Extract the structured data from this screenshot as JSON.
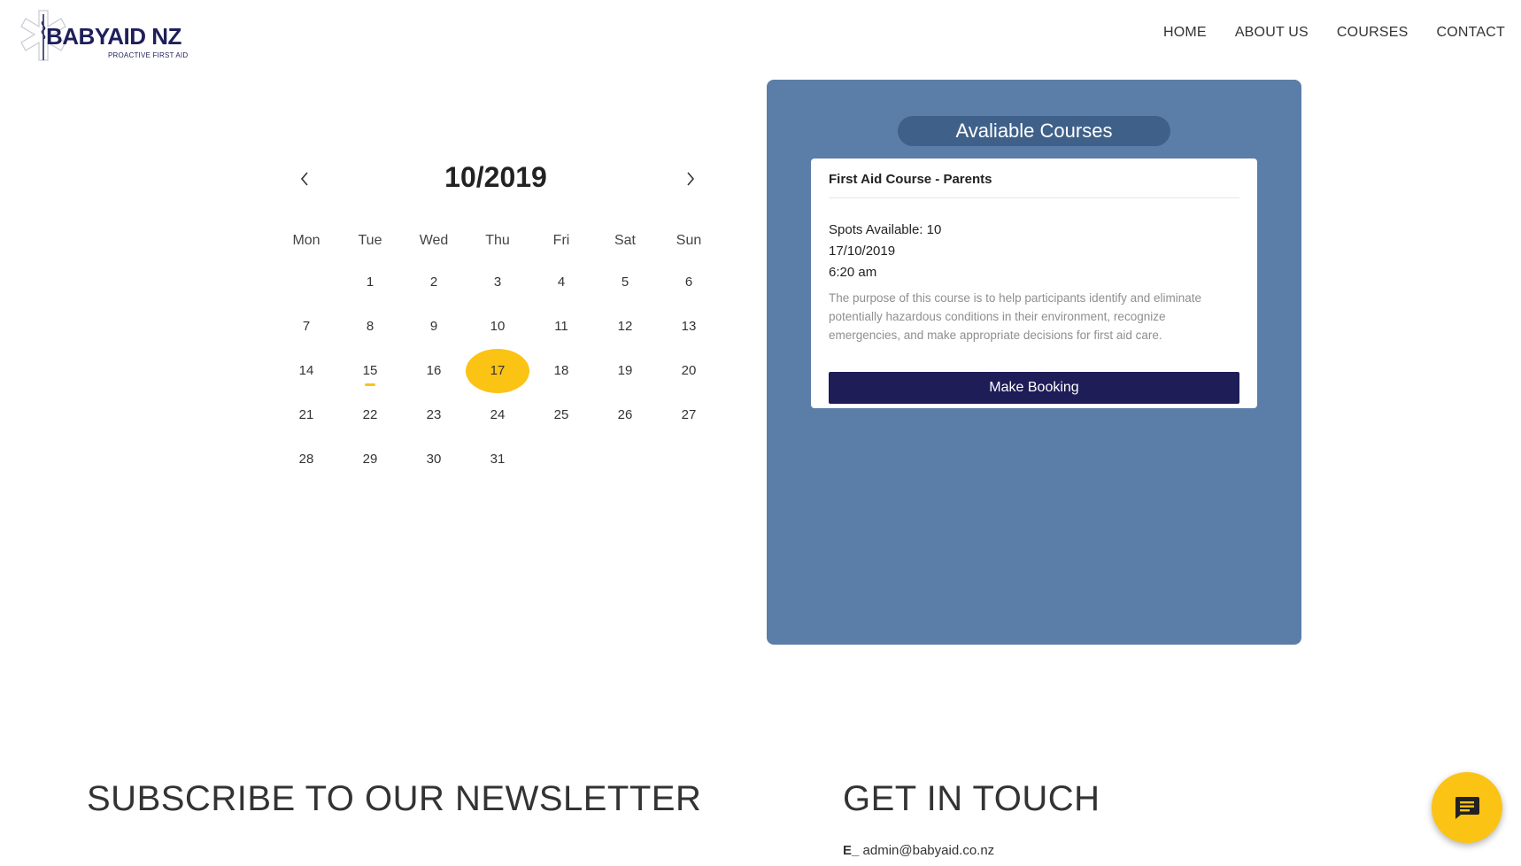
{
  "header": {
    "logo_text": "BABYAID NZ",
    "logo_tagline": "PROACTIVE FIRST AID",
    "nav": [
      "HOME",
      "ABOUT US",
      "COURSES",
      "CONTACT"
    ]
  },
  "calendar": {
    "title": "10/2019",
    "weekdays": [
      "Mon",
      "Tue",
      "Wed",
      "Thu",
      "Fri",
      "Sat",
      "Sun"
    ],
    "leading_blanks": 1,
    "days_in_month": 31,
    "selected_day": 17,
    "event_days": [
      15
    ],
    "prev_icon": "chevron-left-icon",
    "next_icon": "chevron-right-icon"
  },
  "courses_panel": {
    "title": "Avaliable Courses",
    "course": {
      "name": "First Aid Course - Parents",
      "spots": "Spots Available: 10",
      "date": "17/10/2019",
      "time": "6:20 am",
      "description": "The purpose of this course is to help participants identify and eliminate potentially hazardous conditions in their environment, recognize emergencies, and make appropriate decisions for first aid care.",
      "button_label": "Make Booking"
    }
  },
  "footer": {
    "newsletter_title": "SUBSCRIBE TO OUR NEWSLETTER",
    "contact_title": "GET IN TOUCH",
    "email_prefix": "E_",
    "email": "admin@babyaid.co.nz"
  },
  "chat": {
    "icon": "chat-icon"
  },
  "colors": {
    "accent_yellow": "#fbc314",
    "panel_blue": "#5b7ea8",
    "panel_title_bg": "#3f6089",
    "button_navy": "#1e1d58",
    "brand_navy": "#1e1f5a"
  }
}
